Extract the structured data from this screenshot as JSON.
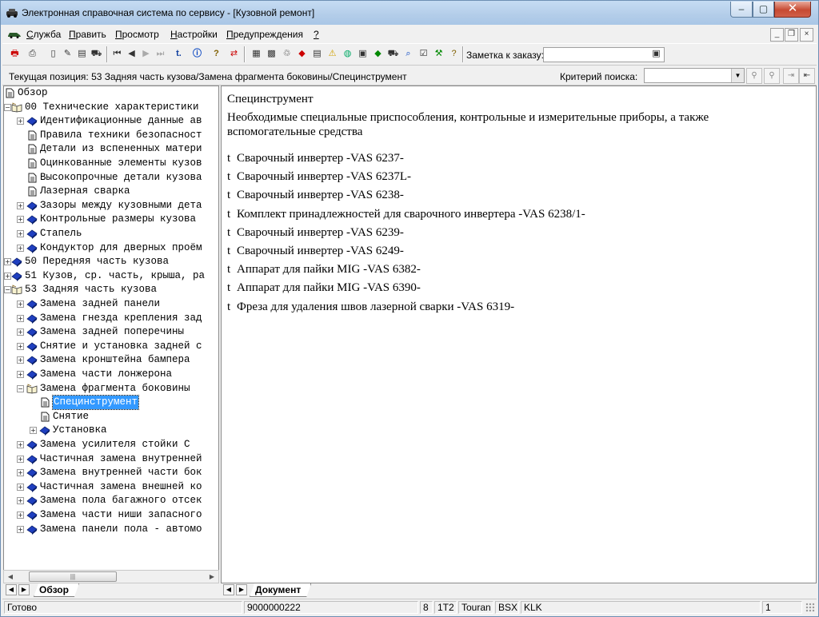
{
  "window": {
    "title": "Электронная справочная система по сервису - [Кузовной ремонт]",
    "minimize": "–",
    "maximize": "▢",
    "close": "✕"
  },
  "menu": [
    {
      "label": "Служба",
      "icon": "car-icon"
    },
    {
      "label": "Править"
    },
    {
      "label": "Просмотр"
    },
    {
      "label": "Настройки"
    },
    {
      "label": "Предупреждения"
    },
    {
      "label": "?"
    }
  ],
  "mdi_controls": {
    "minimize": "_",
    "restore": "❐",
    "close": "×"
  },
  "toolbar": {
    "buttons": [
      "print-red-icon",
      "printer-icon",
      "page-icon",
      "edit-page-icon",
      "notes-icon",
      "car-icon",
      "first-icon",
      "prev-icon",
      "next-icon",
      "last-icon",
      "up-level-icon",
      "info-icon",
      "help-icon",
      "sync-icon",
      "doc-icon",
      "grid-icon",
      "tree-icon",
      "book-icon",
      "list-icon",
      "warning-icon",
      "globe-icon",
      "save-icon",
      "leaf-icon",
      "car-small-icon",
      "search-car-icon",
      "checklist-icon",
      "tools-icon",
      "hint-icon"
    ],
    "note_label": "Заметка к заказу:",
    "note_value": "",
    "note_button_icon": "note-window-icon"
  },
  "position": {
    "text": "Текущая позиция: 53 Задняя часть кузова/Замена фрагмента боковины/Специнструмент",
    "criterion_label": "Критерий поиска:",
    "criterion_value": "",
    "buttons": [
      "search-person-icon",
      "search-person-2-icon",
      "arrow-left-icon",
      "arrow-right-icon"
    ]
  },
  "tree": [
    {
      "level": 0,
      "label": "Обзор",
      "icon": "page",
      "expand": "none"
    },
    {
      "level": 0,
      "label": "00 Технические характеристики",
      "icon": "open-book",
      "expand": "minus"
    },
    {
      "level": 1,
      "label": "Идентификационные данные ав",
      "icon": "book",
      "expand": "plus"
    },
    {
      "level": 1,
      "label": "Правила техники безопасност",
      "icon": "page",
      "expand": "none"
    },
    {
      "level": 1,
      "label": "Детали из вспененных матери",
      "icon": "page",
      "expand": "none"
    },
    {
      "level": 1,
      "label": "Оцинкованные элементы кузов",
      "icon": "page",
      "expand": "none"
    },
    {
      "level": 1,
      "label": "Высокопрочные детали кузова",
      "icon": "page",
      "expand": "none"
    },
    {
      "level": 1,
      "label": "Лазерная сварка",
      "icon": "page",
      "expand": "none"
    },
    {
      "level": 1,
      "label": "Зазоры между кузовными дета",
      "icon": "book",
      "expand": "plus"
    },
    {
      "level": 1,
      "label": "Контрольные размеры кузова",
      "icon": "book",
      "expand": "plus"
    },
    {
      "level": 1,
      "label": "Стапель",
      "icon": "book",
      "expand": "plus"
    },
    {
      "level": 1,
      "label": "Кондуктор для дверных проём",
      "icon": "book",
      "expand": "plus"
    },
    {
      "level": 0,
      "label": "50 Передняя часть кузова",
      "icon": "book",
      "expand": "plus"
    },
    {
      "level": 0,
      "label": "51 Кузов, ср. часть, крыша, ра",
      "icon": "book",
      "expand": "plus"
    },
    {
      "level": 0,
      "label": "53 Задняя часть кузова",
      "icon": "open-book",
      "expand": "minus"
    },
    {
      "level": 1,
      "label": "Замена задней панели",
      "icon": "book",
      "expand": "plus"
    },
    {
      "level": 1,
      "label": "Замена гнезда крепления зад",
      "icon": "book",
      "expand": "plus"
    },
    {
      "level": 1,
      "label": "Замена задней поперечины",
      "icon": "book",
      "expand": "plus"
    },
    {
      "level": 1,
      "label": "Снятие и установка задней с",
      "icon": "book",
      "expand": "plus"
    },
    {
      "level": 1,
      "label": "Замена кронштейна бампера",
      "icon": "book",
      "expand": "plus"
    },
    {
      "level": 1,
      "label": "Замена части лонжерона",
      "icon": "book",
      "expand": "plus"
    },
    {
      "level": 1,
      "label": "Замена фрагмента боковины",
      "icon": "open-book",
      "expand": "minus"
    },
    {
      "level": 2,
      "label": "Специнструмент",
      "icon": "page",
      "expand": "none",
      "selected": true
    },
    {
      "level": 2,
      "label": "Снятие",
      "icon": "page",
      "expand": "none"
    },
    {
      "level": 2,
      "label": "Установка",
      "icon": "book",
      "expand": "plus"
    },
    {
      "level": 1,
      "label": "Замена усилителя стойки С",
      "icon": "book",
      "expand": "plus"
    },
    {
      "level": 1,
      "label": "Частичная замена внутренней",
      "icon": "book",
      "expand": "plus"
    },
    {
      "level": 1,
      "label": "Замена внутренней части бок",
      "icon": "book",
      "expand": "plus"
    },
    {
      "level": 1,
      "label": "Частичная замена внешней ко",
      "icon": "book",
      "expand": "plus"
    },
    {
      "level": 1,
      "label": "Замена пола багажного отсек",
      "icon": "book",
      "expand": "plus"
    },
    {
      "level": 1,
      "label": "Замена части ниши запасного",
      "icon": "book",
      "expand": "plus"
    },
    {
      "level": 1,
      "label": "Замена панели пола - автомо",
      "icon": "book",
      "expand": "plus"
    }
  ],
  "left_tab": "Обзор",
  "right_tab": "Документ",
  "document": {
    "title": "Специнструмент",
    "intro": "Необходимые специальные приспособления, контрольные и измерительные приборы, а также вспомогательные средства",
    "bullet": "t",
    "items": [
      "Сварочный инвертер -VAS 6237-",
      "Сварочный инвертер -VAS 6237L-",
      "Сварочный инвертер -VAS 6238-",
      "Комплект принадлежностей для сварочного инвертера -VAS 6238/1-",
      "Сварочный инвертер -VAS 6239-",
      "Сварочный инвертер -VAS 6249-",
      "Аппарат для пайки MIG -VAS 6382-",
      "Аппарат для пайки MIG -VAS 6390-",
      "Фреза для удаления швов лазерной сварки -VAS 6319-"
    ]
  },
  "status": {
    "ready": "Готово",
    "code": "9000000222",
    "f1": "8",
    "f2": "1T2",
    "f3": "Touran",
    "f4": "BSX",
    "f5": "KLK",
    "page": "1"
  },
  "colors": {
    "book_blue": "#1f3fbf",
    "selection": "#3399ff",
    "title_gradient_top": "#c6dcf3",
    "close_red": "#c74a32"
  }
}
